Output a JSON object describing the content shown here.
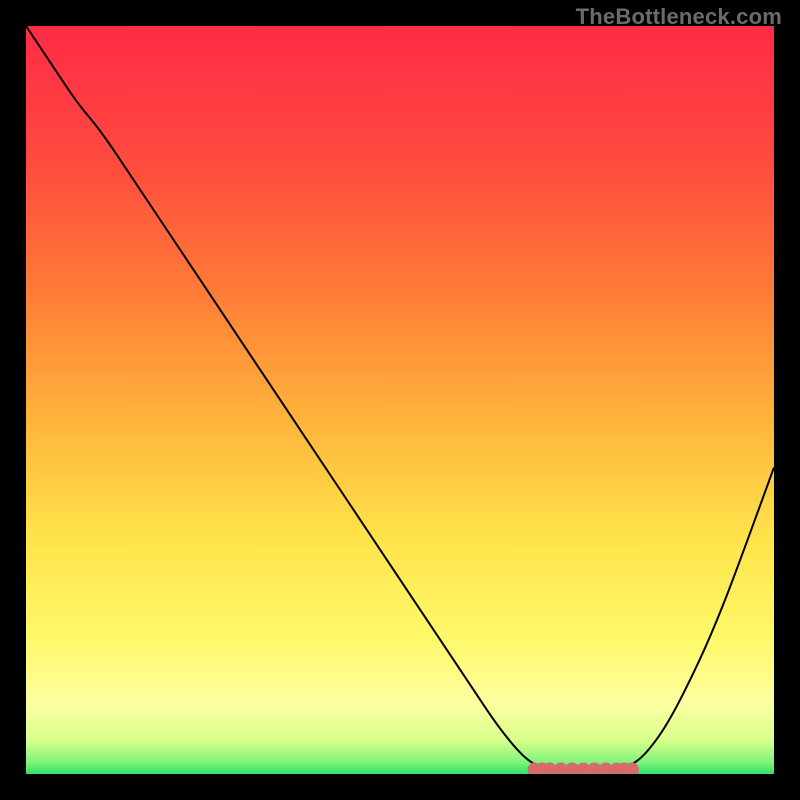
{
  "watermark": "TheBottleneck.com",
  "chart_data": {
    "type": "line",
    "title": "",
    "xlabel": "",
    "ylabel": "",
    "xlim": [
      0,
      100
    ],
    "ylim": [
      0,
      100
    ],
    "grid": false,
    "legend": false,
    "curve_points": [
      {
        "x": 0,
        "y": 100.0
      },
      {
        "x": 4,
        "y": 94.0
      },
      {
        "x": 7,
        "y": 89.5
      },
      {
        "x": 10,
        "y": 86.0
      },
      {
        "x": 15,
        "y": 78.5
      },
      {
        "x": 20,
        "y": 71.0
      },
      {
        "x": 25,
        "y": 63.5
      },
      {
        "x": 30,
        "y": 56.0
      },
      {
        "x": 35,
        "y": 48.5
      },
      {
        "x": 40,
        "y": 41.0
      },
      {
        "x": 45,
        "y": 33.5
      },
      {
        "x": 50,
        "y": 26.0
      },
      {
        "x": 55,
        "y": 18.5
      },
      {
        "x": 60,
        "y": 11.0
      },
      {
        "x": 63,
        "y": 6.5
      },
      {
        "x": 66,
        "y": 2.8
      },
      {
        "x": 68,
        "y": 1.2
      },
      {
        "x": 70,
        "y": 0.4
      },
      {
        "x": 73,
        "y": 0.0
      },
      {
        "x": 76,
        "y": 0.0
      },
      {
        "x": 79,
        "y": 0.4
      },
      {
        "x": 81,
        "y": 1.2
      },
      {
        "x": 83,
        "y": 2.8
      },
      {
        "x": 86,
        "y": 7.0
      },
      {
        "x": 90,
        "y": 15.0
      },
      {
        "x": 93,
        "y": 22.0
      },
      {
        "x": 96,
        "y": 30.0
      },
      {
        "x": 100,
        "y": 41.0
      }
    ],
    "marker_points_x": [
      68,
      69,
      70,
      71.5,
      73,
      74.5,
      76,
      77.5,
      79,
      80,
      81
    ],
    "marker_y": 0.6,
    "background_gradient": {
      "stops": [
        {
          "offset": 0.0,
          "color": "#ff2b46"
        },
        {
          "offset": 0.18,
          "color": "#ff4a3f"
        },
        {
          "offset": 0.35,
          "color": "#ff7a38"
        },
        {
          "offset": 0.52,
          "color": "#ffb23a"
        },
        {
          "offset": 0.68,
          "color": "#ffe24a"
        },
        {
          "offset": 0.82,
          "color": "#fff96a"
        },
        {
          "offset": 0.905,
          "color": "#fdffa0"
        },
        {
          "offset": 0.955,
          "color": "#d9ff8c"
        },
        {
          "offset": 0.985,
          "color": "#7cf47a"
        },
        {
          "offset": 1.0,
          "color": "#2fe06a"
        }
      ]
    },
    "curve_stroke": "#000000",
    "marker_fill": "#d76a6a",
    "marker_radius_px": 7
  }
}
